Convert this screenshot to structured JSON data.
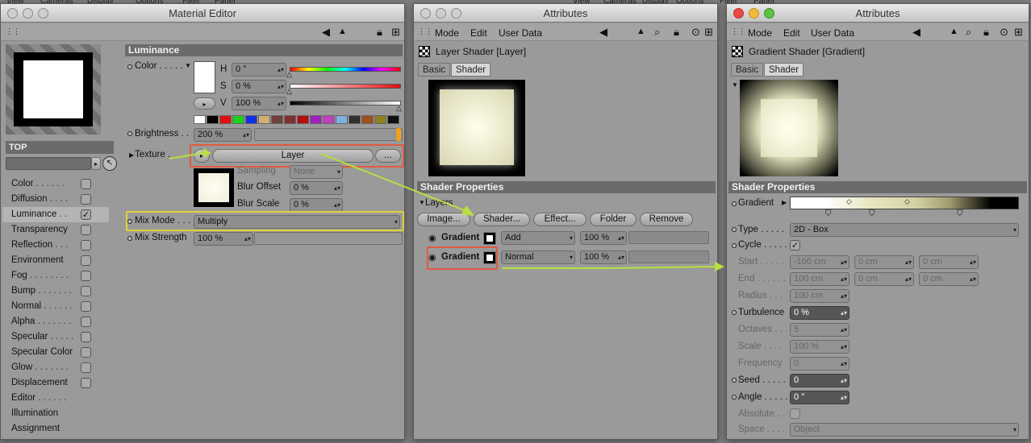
{
  "bg": {
    "menu_left": [
      "View",
      "Cameras",
      "Display",
      "Options",
      "Filter",
      "Panel"
    ],
    "menu_mid": [
      "View",
      "Cameras",
      "Display",
      "Options"
    ],
    "menu_right": [
      "Filter",
      "Panel"
    ]
  },
  "material_editor": {
    "title": "Material Editor",
    "material_name": "TOP",
    "channels": [
      {
        "label": "Color",
        "checked": false
      },
      {
        "label": "Diffusion",
        "checked": false
      },
      {
        "label": "Luminance",
        "checked": true
      },
      {
        "label": "Transparency",
        "checked": false
      },
      {
        "label": "Reflection",
        "checked": false
      },
      {
        "label": "Environment",
        "checked": false
      },
      {
        "label": "Fog",
        "checked": false
      },
      {
        "label": "Bump",
        "checked": false
      },
      {
        "label": "Normal",
        "checked": false
      },
      {
        "label": "Alpha",
        "checked": false
      },
      {
        "label": "Specular",
        "checked": false
      },
      {
        "label": "Specular Color",
        "checked": false
      },
      {
        "label": "Glow",
        "checked": false
      },
      {
        "label": "Displacement",
        "checked": false
      }
    ],
    "extra_items": [
      "Editor",
      "Illumination",
      "Assignment"
    ],
    "section": "Luminance",
    "color_label": "Color",
    "h_label": "H",
    "h_value": "0 °",
    "s_label": "S",
    "s_value": "0 %",
    "v_label": "V",
    "v_value": "100 %",
    "brightness_label": "Brightness",
    "brightness_value": "200 %",
    "brightness_level": 1.0,
    "texture_label": "Texture",
    "texture_button": "Layer",
    "texture_more": "...",
    "sampling_label": "Sampling",
    "sampling_value": "None",
    "blur_offset_label": "Blur Offset",
    "blur_offset_value": "0 %",
    "blur_scale_label": "Blur Scale",
    "blur_scale_value": "0 %",
    "mix_mode_label": "Mix Mode",
    "mix_mode_value": "Multiply",
    "mix_strength_label": "Mix Strength",
    "mix_strength_value": "100 %",
    "mix_strength_level": 1.0,
    "palette": [
      "#ffffff",
      "#000000",
      "#e01010",
      "#20d020",
      "#1030e0",
      "#d4b070",
      "#704040",
      "#803030",
      "#b01010",
      "#a020c0",
      "#c040c0",
      "#80b0e0",
      "#303030",
      "#a05020",
      "#908020",
      "#101010"
    ]
  },
  "layer_attributes": {
    "title": "Attributes",
    "menu": [
      "Mode",
      "Edit",
      "User Data"
    ],
    "shader_title": "Layer Shader [Layer]",
    "tabs": [
      "Basic",
      "Shader"
    ],
    "section": "Shader Properties",
    "layers_label": "Layers",
    "buttons": [
      "Image...",
      "Shader...",
      "Effect...",
      "Folder",
      "Remove"
    ],
    "rows": [
      {
        "name": "Gradient",
        "mode": "Add",
        "value": "100 %"
      },
      {
        "name": "Gradient",
        "mode": "Normal",
        "value": "100 %"
      }
    ]
  },
  "gradient_attributes": {
    "title": "Attributes",
    "menu": [
      "Mode",
      "Edit",
      "User Data"
    ],
    "shader_title": "Gradient Shader [Gradient]",
    "tabs": [
      "Basic",
      "Shader"
    ],
    "section": "Shader Properties",
    "gradient_label": "Gradient",
    "type_label": "Type",
    "type_value": "2D - Box",
    "cycle_label": "Cycle",
    "start_label": "Start",
    "start_values": [
      "-100 cm",
      "0 cm",
      "0 cm"
    ],
    "end_label": "End",
    "end_values": [
      "100 cm",
      "0 cm",
      "0 cm"
    ],
    "radius_label": "Radius",
    "radius_value": "100 cm",
    "turbulence_label": "Turbulence",
    "turbulence_value": "0 %",
    "octaves_label": "Octaves",
    "octaves_value": "5",
    "scale_label": "Scale",
    "scale_value": "100 %",
    "frequency_label": "Frequency",
    "frequency_value": "0",
    "seed_label": "Seed",
    "seed_value": "0",
    "angle_label": "Angle",
    "angle_value": "0 °",
    "absolute_label": "Absolute",
    "space_label": "Space",
    "space_value": "Object"
  },
  "colors": {
    "highlight_red": "#e05b40",
    "highlight_yellow": "#e1d23a",
    "arrow": "#b8e040",
    "slider_handle": "#f0a020"
  }
}
